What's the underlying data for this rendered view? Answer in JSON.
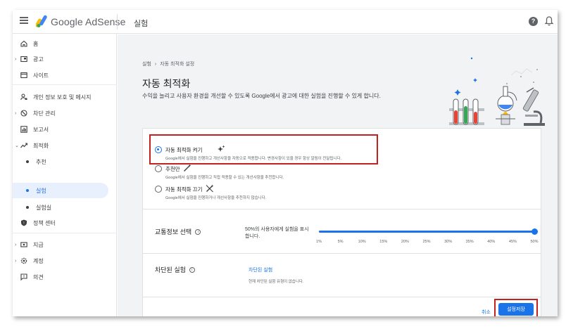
{
  "header": {
    "app_name": "Google AdSense",
    "page_title": "실험",
    "help_label": "?"
  },
  "sidebar": {
    "items": [
      {
        "label": "홈",
        "icon": "home-icon"
      },
      {
        "label": "광고",
        "icon": "ads-icon"
      },
      {
        "label": "사이트",
        "icon": "sites-icon"
      },
      {
        "label": "개인 정보 보호 및 메시지",
        "icon": "privacy-icon"
      },
      {
        "label": "차단 관리",
        "icon": "block-icon"
      },
      {
        "label": "보고서",
        "icon": "reports-icon"
      },
      {
        "label": "최적화",
        "icon": "optimization-icon"
      },
      {
        "label": "추천"
      },
      {
        "label": "실험"
      },
      {
        "label": "실험실"
      },
      {
        "label": "정책 센터",
        "icon": "policy-icon"
      },
      {
        "label": "지급",
        "icon": "payments-icon"
      },
      {
        "label": "계정",
        "icon": "account-icon"
      },
      {
        "label": "의견",
        "icon": "feedback-icon"
      }
    ]
  },
  "main": {
    "breadcrumb": [
      "실험",
      "자동 최적화 설정"
    ],
    "breadcrumb_sep": "›",
    "title": "자동 최적화",
    "description": "수익을 늘리고 사용자 환경을 개선할 수 있도록 Google에서 광고에 대한 실험을 진행할 수 있게 합니다.",
    "options": [
      {
        "label": "자동 최적화 켜기",
        "desc": "Google에서 실험을 진행하고 개선사항을 자동으로 적용합니다. 변경사항이 있을 경우 항상 알림이 전달됩니다.",
        "selected": true
      },
      {
        "label": "추천만",
        "desc": "Google에서 실험을 진행하고 직접 적용할 수 있는 개선사항을 추천합니다.",
        "selected": false
      },
      {
        "label": "자동 최적화 끄기",
        "desc": "Google에서 실험을 진행하거나 개선사항을 추천하지 않습니다.",
        "selected": false
      }
    ],
    "traffic": {
      "label": "교통정보 선택",
      "info": "i",
      "desc": "50%의 사용자에게 실험을 표시합니다.",
      "value_percent": 50,
      "ticks": [
        "1%",
        "5%",
        "10%",
        "15%",
        "20%",
        "25%",
        "30%",
        "35%",
        "40%",
        "45%",
        "50%"
      ]
    },
    "blocked": {
      "label": "차단된 실험",
      "info": "i",
      "link": "차단된 실험",
      "note": "현재 차단된 실험 유형이 없습니다."
    },
    "actions": {
      "cancel": "취소",
      "save": "설정저장"
    }
  },
  "colors": {
    "accent": "#1a73e8",
    "highlight": "#c5221f"
  }
}
